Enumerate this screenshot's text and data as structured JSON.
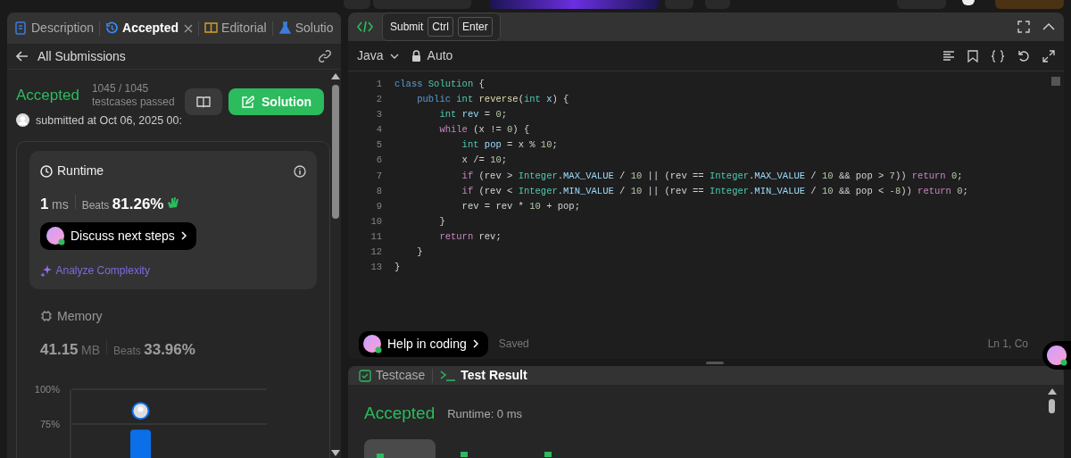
{
  "left_panel": {
    "tabs": [
      {
        "label": "Description",
        "selected": false,
        "closable": false
      },
      {
        "label": "Accepted",
        "selected": true,
        "closable": true
      },
      {
        "label": "Editorial",
        "selected": false,
        "closable": false
      },
      {
        "label": "Solutio",
        "selected": false,
        "closable": false
      }
    ],
    "back_link": "All Submissions",
    "submission": {
      "status": "Accepted",
      "passed": "1045 / 1045",
      "passed_label": "testcases passed",
      "submitted": "submitted at Oct 06, 2025 00:",
      "solution_button": "Solution"
    },
    "metrics": [
      {
        "title": "Runtime",
        "selected": true,
        "value": "1",
        "unit": "ms",
        "beats_label": "Beats",
        "beats": "81.26%",
        "discuss_button": "Discuss next steps",
        "analyze_link": "Analyze Complexity"
      },
      {
        "title": "Memory",
        "selected": false,
        "value": "41.15",
        "unit": "MB",
        "beats_label": "Beats",
        "beats": "33.96%"
      }
    ],
    "chart_data": {
      "type": "bar",
      "values": [
        71
      ],
      "ylim": [
        50,
        100
      ],
      "yticks": [
        {
          "value": 100,
          "label": "100%"
        },
        {
          "value": 75,
          "label": "75%"
        }
      ]
    }
  },
  "editor": {
    "tooltip": {
      "label": "Submit",
      "keys": [
        "Ctrl",
        "Enter"
      ]
    },
    "language": "Java",
    "mode": "Auto",
    "lines": [
      {
        "number": "1",
        "tokens": [
          {
            "text": "class ",
            "kind": "keyword"
          },
          {
            "text": "Solution",
            "kind": "type"
          },
          {
            "text": " {",
            "kind": "plain"
          }
        ]
      },
      {
        "number": "2",
        "tokens": [
          {
            "text": "    public ",
            "kind": "keyword"
          },
          {
            "text": "int ",
            "kind": "type"
          },
          {
            "text": "reverse",
            "kind": "function"
          },
          {
            "text": "(",
            "kind": "plain"
          },
          {
            "text": "int ",
            "kind": "type"
          },
          {
            "text": "x",
            "kind": "variable"
          },
          {
            "text": ") {",
            "kind": "plain"
          }
        ]
      },
      {
        "number": "3",
        "tokens": [
          {
            "text": "        int ",
            "kind": "type"
          },
          {
            "text": "rev",
            "kind": "variable"
          },
          {
            "text": " = ",
            "kind": "plain"
          },
          {
            "text": "0",
            "kind": "number"
          },
          {
            "text": ";",
            "kind": "plain"
          }
        ]
      },
      {
        "number": "4",
        "tokens": [
          {
            "text": "        while",
            "kind": "control"
          },
          {
            "text": " (x != ",
            "kind": "plain"
          },
          {
            "text": "0",
            "kind": "number"
          },
          {
            "text": ") {",
            "kind": "plain"
          }
        ]
      },
      {
        "number": "5",
        "tokens": [
          {
            "text": "            int ",
            "kind": "type"
          },
          {
            "text": "pop",
            "kind": "variable"
          },
          {
            "text": " = x % ",
            "kind": "plain"
          },
          {
            "text": "10",
            "kind": "number"
          },
          {
            "text": ";",
            "kind": "plain"
          }
        ]
      },
      {
        "number": "6",
        "tokens": [
          {
            "text": "            x /= ",
            "kind": "plain"
          },
          {
            "text": "10",
            "kind": "number"
          },
          {
            "text": ";",
            "kind": "plain"
          }
        ]
      },
      {
        "number": "7",
        "tokens": [
          {
            "text": "            if",
            "kind": "control"
          },
          {
            "text": " (rev > ",
            "kind": "plain"
          },
          {
            "text": "Integer",
            "kind": "type"
          },
          {
            "text": ".",
            "kind": "plain"
          },
          {
            "text": "MAX_VALUE",
            "kind": "variable"
          },
          {
            "text": " / ",
            "kind": "plain"
          },
          {
            "text": "10",
            "kind": "number"
          },
          {
            "text": " || (rev == ",
            "kind": "plain"
          },
          {
            "text": "Integer",
            "kind": "type"
          },
          {
            "text": ".",
            "kind": "plain"
          },
          {
            "text": "MAX_VALUE",
            "kind": "variable"
          },
          {
            "text": " / ",
            "kind": "plain"
          },
          {
            "text": "10",
            "kind": "number"
          },
          {
            "text": " && pop > ",
            "kind": "plain"
          },
          {
            "text": "7",
            "kind": "number"
          },
          {
            "text": ")) ",
            "kind": "plain"
          },
          {
            "text": "return ",
            "kind": "control"
          },
          {
            "text": "0",
            "kind": "number"
          },
          {
            "text": ";",
            "kind": "plain"
          }
        ]
      },
      {
        "number": "8",
        "tokens": [
          {
            "text": "            if",
            "kind": "control"
          },
          {
            "text": " (rev < ",
            "kind": "plain"
          },
          {
            "text": "Integer",
            "kind": "type"
          },
          {
            "text": ".",
            "kind": "plain"
          },
          {
            "text": "MIN_VALUE",
            "kind": "variable"
          },
          {
            "text": " / ",
            "kind": "plain"
          },
          {
            "text": "10",
            "kind": "number"
          },
          {
            "text": " || (rev == ",
            "kind": "plain"
          },
          {
            "text": "Integer",
            "kind": "type"
          },
          {
            "text": ".",
            "kind": "plain"
          },
          {
            "text": "MIN_VALUE",
            "kind": "variable"
          },
          {
            "text": " / ",
            "kind": "plain"
          },
          {
            "text": "10",
            "kind": "number"
          },
          {
            "text": " && pop < ",
            "kind": "plain"
          },
          {
            "text": "-8",
            "kind": "number"
          },
          {
            "text": ")) ",
            "kind": "plain"
          },
          {
            "text": "return ",
            "kind": "control"
          },
          {
            "text": "0",
            "kind": "number"
          },
          {
            "text": ";",
            "kind": "plain"
          }
        ]
      },
      {
        "number": "9",
        "tokens": [
          {
            "text": "            rev = rev * ",
            "kind": "plain"
          },
          {
            "text": "10",
            "kind": "number"
          },
          {
            "text": " + pop;",
            "kind": "plain"
          }
        ]
      },
      {
        "number": "10",
        "tokens": [
          {
            "text": "        }",
            "kind": "plain"
          }
        ]
      },
      {
        "number": "11",
        "tokens": [
          {
            "text": "        return",
            "kind": "control"
          },
          {
            "text": " rev;",
            "kind": "plain"
          }
        ]
      },
      {
        "number": "12",
        "tokens": [
          {
            "text": "    }",
            "kind": "plain"
          }
        ]
      },
      {
        "number": "13",
        "tokens": [
          {
            "text": "}",
            "kind": "plain"
          }
        ]
      }
    ],
    "help_button": "Help in coding",
    "save_status": "Saved",
    "cursor": "Ln 1, Co"
  },
  "console": {
    "tabs": [
      {
        "label": "Testcase",
        "selected": false
      },
      {
        "label": "Test Result",
        "selected": true
      }
    ],
    "result": "Accepted",
    "runtime": "Runtime: 0 ms",
    "cases": [
      {
        "selected": true
      },
      {
        "selected": false
      },
      {
        "selected": false
      }
    ]
  }
}
